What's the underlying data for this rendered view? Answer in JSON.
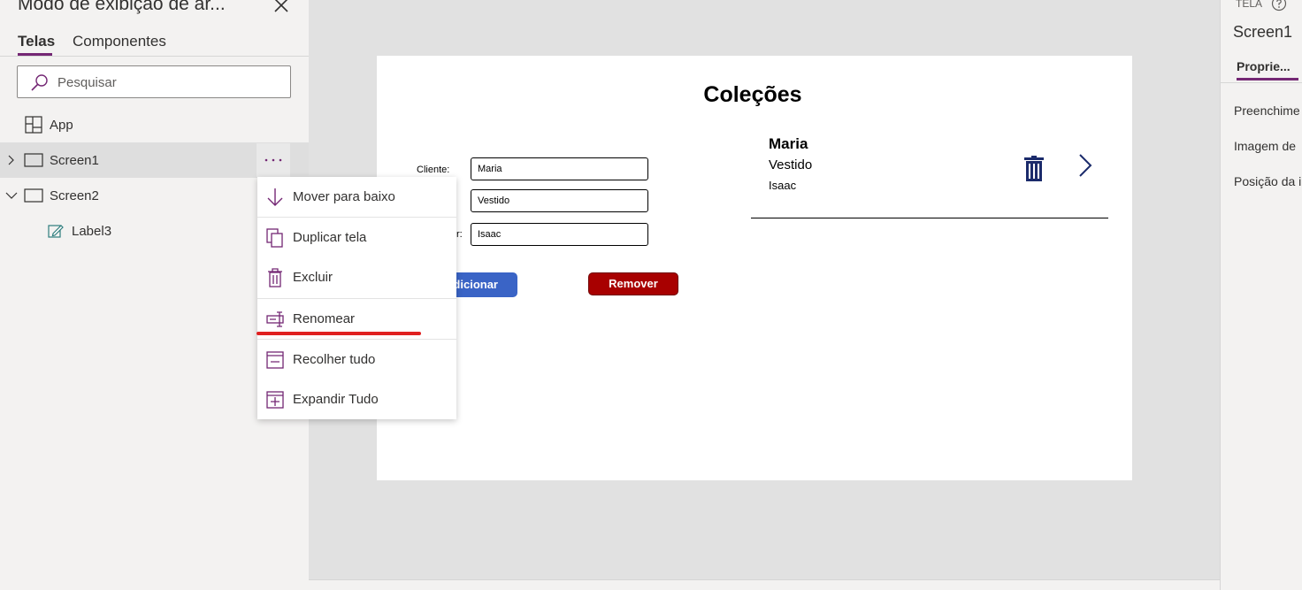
{
  "left_panel": {
    "title": "Modo de exibição de ár...",
    "tabs": [
      {
        "label": "Telas",
        "active": true
      },
      {
        "label": "Componentes",
        "active": false
      }
    ],
    "search": {
      "placeholder": "Pesquisar"
    },
    "tree": [
      {
        "label": "App",
        "icon": "app-grid-icon"
      },
      {
        "label": "Screen1",
        "icon": "screen-icon",
        "expanded": false,
        "selected": true
      },
      {
        "label": "Screen2",
        "icon": "screen-icon",
        "expanded": true
      },
      {
        "label": "Label3",
        "icon": "label-edit-icon"
      }
    ]
  },
  "context_menu": {
    "items": [
      {
        "label": "Mover para baixo",
        "icon": "arrow-down-icon"
      },
      {
        "label": "Duplicar tela",
        "icon": "copy-icon"
      },
      {
        "label": "Excluir",
        "icon": "trash-icon"
      },
      {
        "label": "Renomear",
        "icon": "rename-icon"
      },
      {
        "label": "Recolher tudo",
        "icon": "collapse-all-icon"
      },
      {
        "label": "Expandir Tudo",
        "icon": "expand-all-icon"
      }
    ]
  },
  "canvas": {
    "title": "Coleções",
    "form": {
      "labels": [
        "Cliente:",
        "r:"
      ],
      "fields": [
        "Maria",
        "Vestido",
        "Isaac"
      ]
    },
    "buttons": {
      "add": "dicionar",
      "remove": "Remover"
    },
    "gallery_item": {
      "name": "Maria",
      "product": "Vestido",
      "seller": "Isaac"
    }
  },
  "right_panel": {
    "type_label": "TELA",
    "screen_name": "Screen1",
    "tab": "Proprie...",
    "properties": [
      "Preenchime",
      "Imagem de",
      "Posição da i"
    ]
  },
  "colors": {
    "accent": "#742774",
    "add_button": "#3a64c6",
    "remove_button": "#a80000",
    "annotation_underline": "#e02020"
  }
}
